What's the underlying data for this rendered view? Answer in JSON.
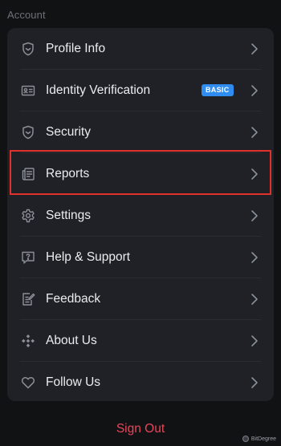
{
  "section": {
    "title": "Account"
  },
  "menu": {
    "items": [
      {
        "label": "Profile Info",
        "icon": "profile-shield-icon"
      },
      {
        "label": "Identity Verification",
        "icon": "id-card-icon",
        "badge": "BASIC"
      },
      {
        "label": "Security",
        "icon": "shield-icon"
      },
      {
        "label": "Reports",
        "icon": "reports-icon",
        "highlighted": true
      },
      {
        "label": "Settings",
        "icon": "gear-icon"
      },
      {
        "label": "Help & Support",
        "icon": "help-chat-icon"
      },
      {
        "label": "Feedback",
        "icon": "feedback-edit-icon"
      },
      {
        "label": "About Us",
        "icon": "logo-diamond-icon"
      },
      {
        "label": "Follow Us",
        "icon": "heart-icon"
      }
    ]
  },
  "signout": {
    "label": "Sign Out"
  },
  "watermark": {
    "text": "BitDegree"
  },
  "colors": {
    "background": "#111214",
    "card": "#1f2126",
    "badge": "#2f8cf0",
    "highlight_border": "#e2302a",
    "signout": "#e8465a"
  }
}
